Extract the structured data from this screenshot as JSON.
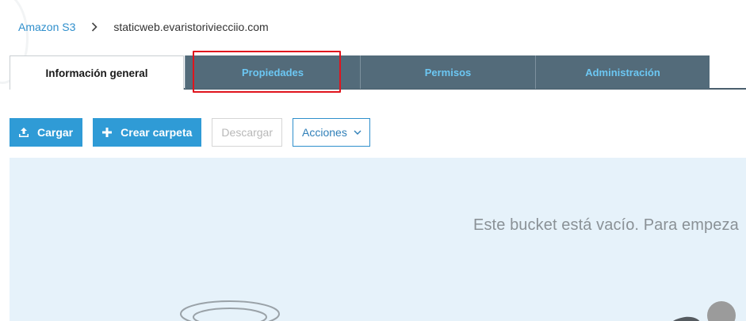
{
  "breadcrumb": {
    "root": "Amazon S3",
    "separator_icon": "chevron-right-icon",
    "current": "staticweb.evaristoriviecciio.com"
  },
  "tabs": [
    {
      "label": "Información general",
      "active": true
    },
    {
      "label": "Propiedades",
      "active": false,
      "highlighted": true
    },
    {
      "label": "Permisos",
      "active": false
    },
    {
      "label": "Administración",
      "active": false
    }
  ],
  "toolbar": {
    "upload": {
      "label": "Cargar",
      "icon": "upload-icon"
    },
    "create_folder": {
      "label": "Crear carpeta",
      "icon": "plus-icon"
    },
    "download": {
      "label": "Descargar",
      "disabled": true
    },
    "actions": {
      "label": "Acciones",
      "icon": "chevron-down-icon"
    }
  },
  "empty_state": {
    "message": "Este bucket está vacío. Para empeza"
  },
  "colors": {
    "link": "#2f8fcc",
    "tab_dark_bg": "#536b7a",
    "tab_dark_text": "#6cc7f3",
    "primary_button": "#2f9bd6",
    "highlight": "#e0141d",
    "empty_panel_bg": "#e6f2fa"
  }
}
